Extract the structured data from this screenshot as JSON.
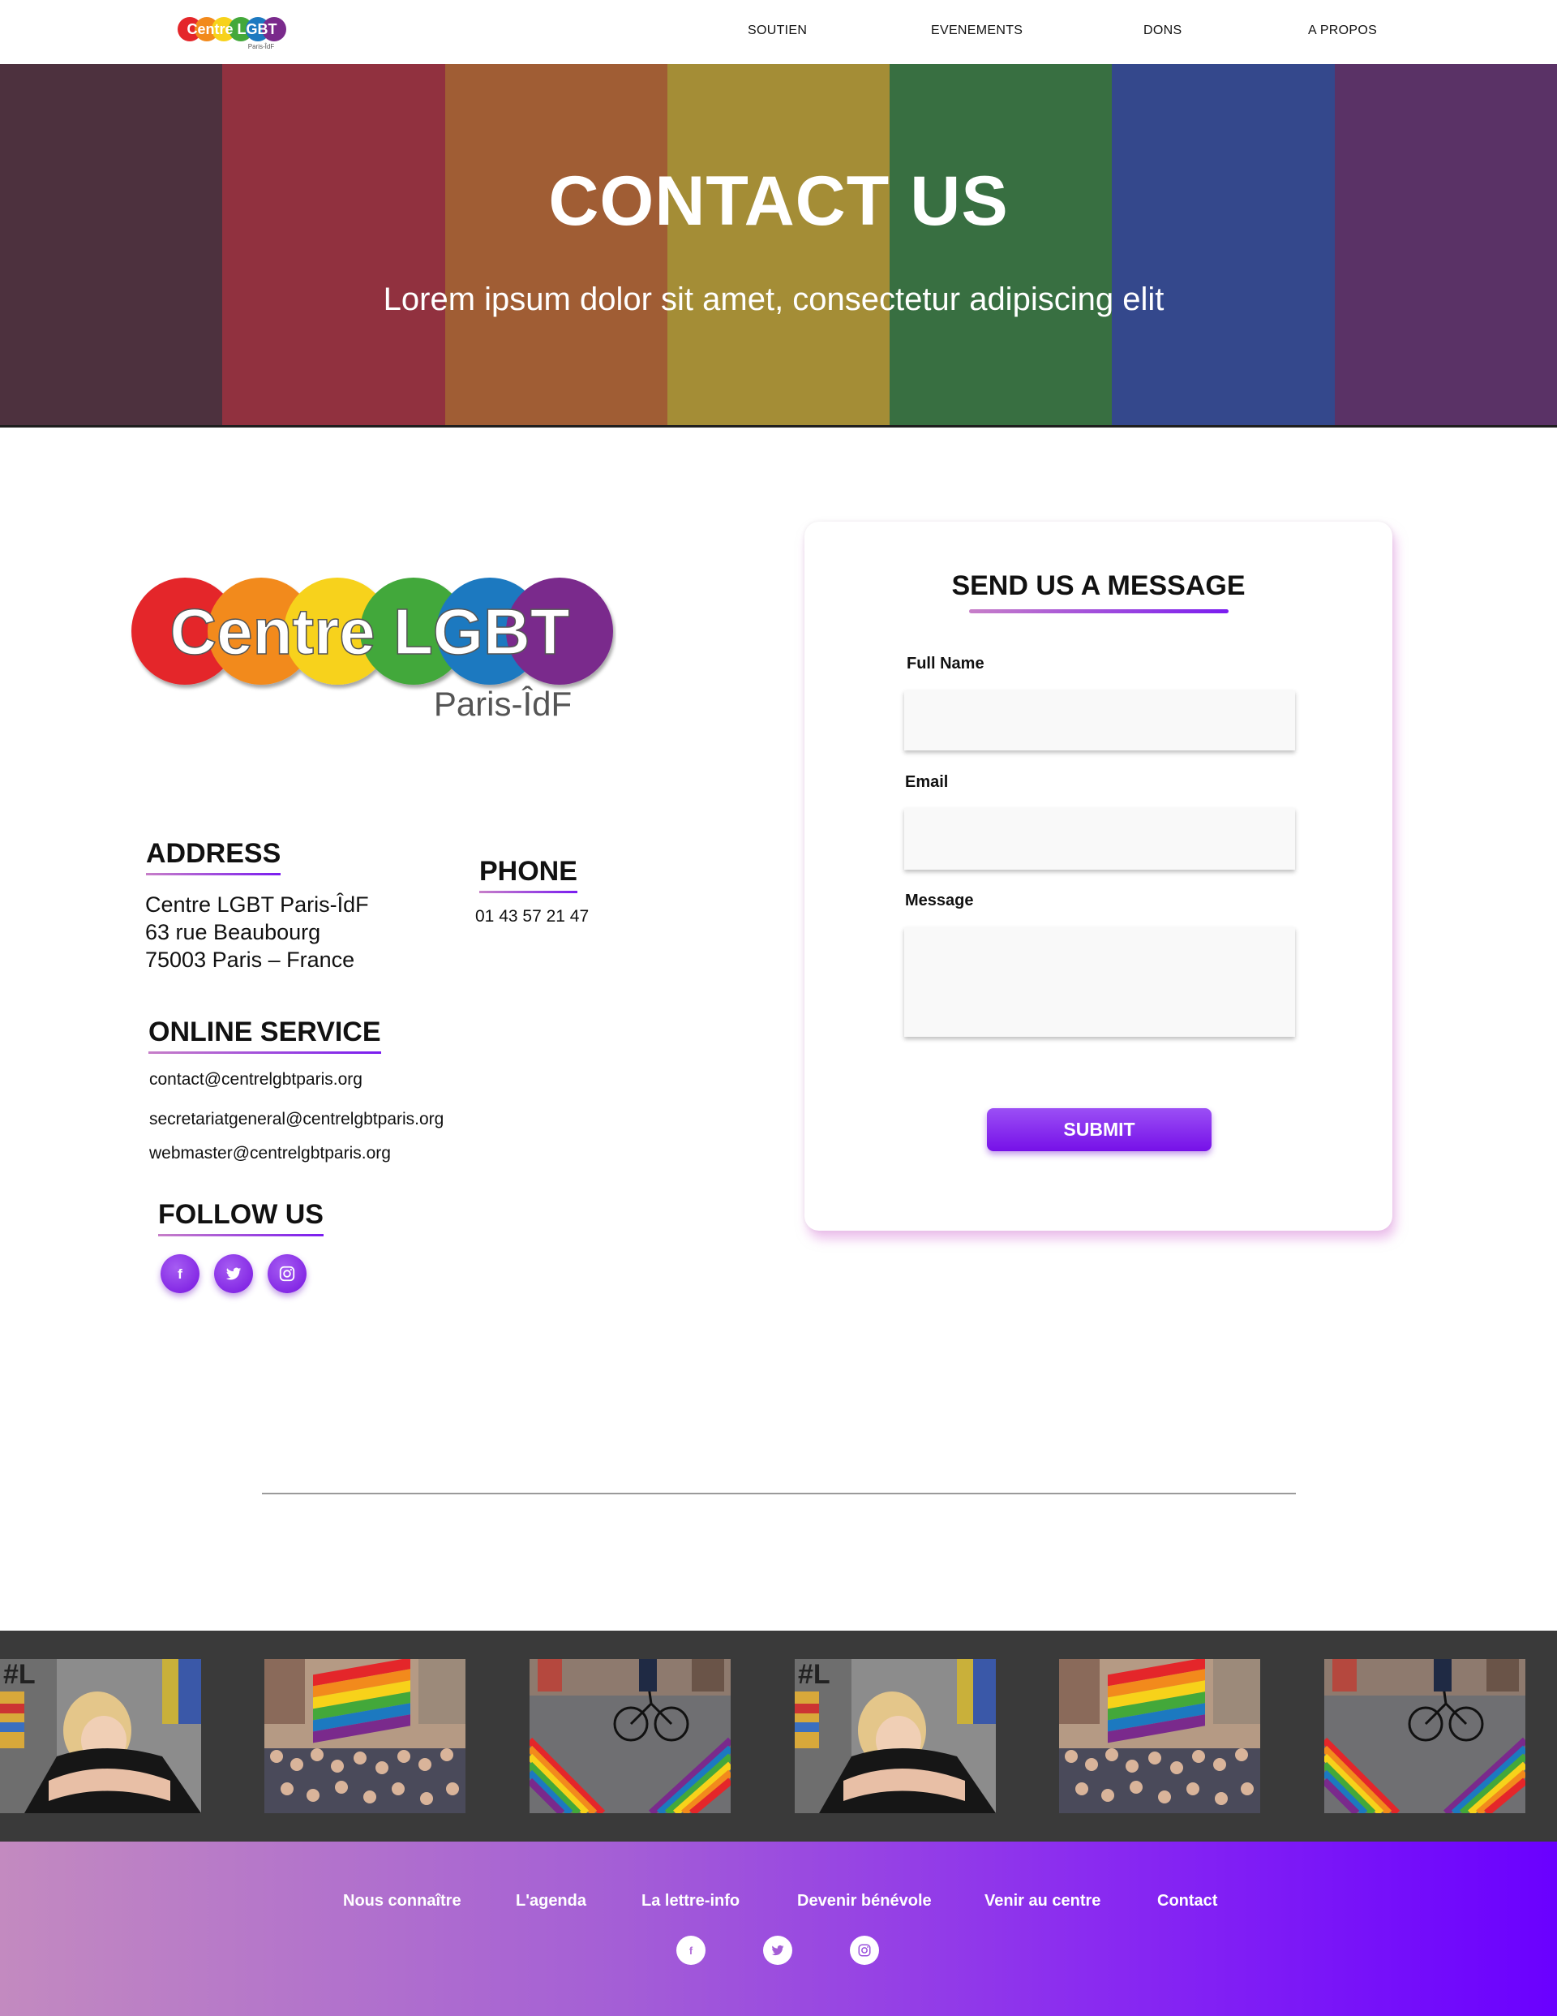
{
  "nav": {
    "logo_text_main": "Centre LGBT",
    "logo_text_sub": "Paris-ÎdF",
    "items": [
      {
        "label": "SOUTIEN"
      },
      {
        "label": "EVENEMENTS"
      },
      {
        "label": "DONS"
      },
      {
        "label": "A PROPOS"
      }
    ]
  },
  "hero": {
    "title": "CONTACT US",
    "subtitle": "Lorem ipsum dolor sit amet, consectetur adipiscing elit",
    "stripe_colors": [
      "#5a3a44",
      "#b13a46",
      "#c47238",
      "#c9b03a",
      "#3f8a48",
      "#3a58a8",
      "#6b3b78"
    ]
  },
  "logo": {
    "text_main": "Centre LGBT",
    "text_sub": "Paris-ÎdF",
    "circle_colors": [
      "#e4262a",
      "#f28a1c",
      "#f7d21a",
      "#43a83a",
      "#1c79c0",
      "#7a2a8c"
    ]
  },
  "contact": {
    "address_heading": "ADDRESS",
    "address_lines": [
      "Centre LGBT Paris-ÎdF",
      "63 rue Beaubourg",
      "75003 Paris – France"
    ],
    "phone_heading": "PHONE",
    "phone": "01 43 57 21 47",
    "online_heading": "ONLINE SERVICE",
    "emails": [
      "contact@centrelgbtparis.org",
      "secretariatgeneral@centrelgbtparis.org",
      "webmaster@centrelgbtparis.org"
    ],
    "follow_heading": "FOLLOW US",
    "social_icons": [
      "facebook-icon",
      "twitter-icon",
      "instagram-icon"
    ]
  },
  "form": {
    "title": "SEND US A MESSAGE",
    "fullname_label": "Full Name",
    "fullname_value": "",
    "email_label": "Email",
    "email_value": "",
    "message_label": "Message",
    "message_value": "",
    "submit_label": "SUBMIT"
  },
  "gallery": {
    "photos": [
      "hug-photo",
      "pride-flag-crowd-photo",
      "rainbow-crosswalk-photo",
      "hug-photo",
      "pride-flag-crowd-photo",
      "rainbow-crosswalk-photo"
    ]
  },
  "footer": {
    "links": [
      {
        "label": "Nous connaître"
      },
      {
        "label": "L'agenda"
      },
      {
        "label": "La lettre-info"
      },
      {
        "label": "Devenir bénévole"
      },
      {
        "label": "Venir au centre"
      },
      {
        "label": "Contact"
      }
    ],
    "social_icons": [
      "facebook-icon",
      "twitter-icon",
      "instagram-icon"
    ]
  },
  "colors": {
    "accent_purple": "#7a1cf0",
    "accent_pink": "#c77fc8",
    "gallery_bg": "#3a3a3a"
  }
}
